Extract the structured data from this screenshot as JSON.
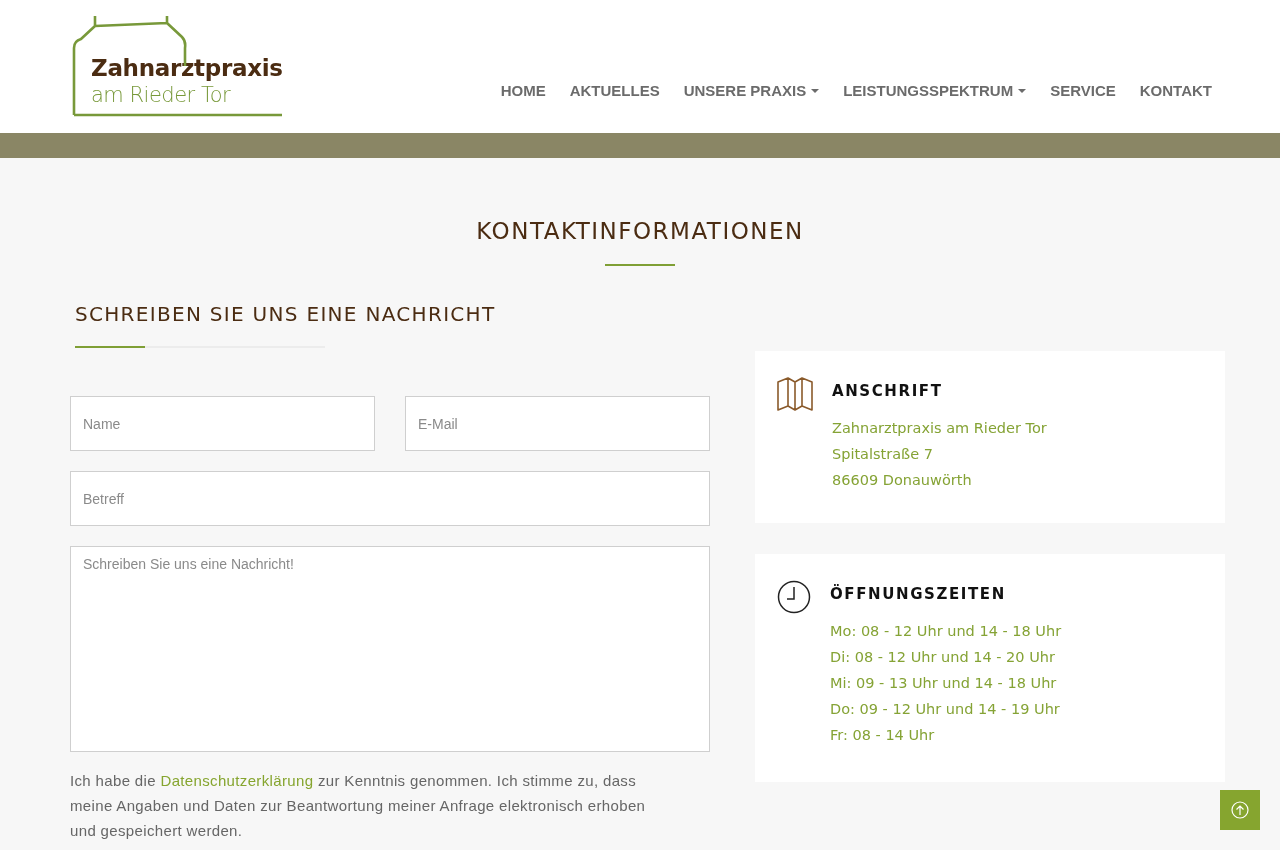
{
  "logo": {
    "name": "Zahnarztpraxis",
    "subtitle": "am Rieder Tor"
  },
  "nav": [
    {
      "label": "HOME",
      "dropdown": false
    },
    {
      "label": "AKTUELLES",
      "dropdown": false
    },
    {
      "label": "UNSERE PRAXIS",
      "dropdown": true
    },
    {
      "label": "LEISTUNGSSPEKTRUM",
      "dropdown": true
    },
    {
      "label": "SERVICE",
      "dropdown": false
    },
    {
      "label": "KONTAKT",
      "dropdown": false
    }
  ],
  "page_title": "KONTAKTINFORMATIONEN",
  "form": {
    "title": "SCHREIBEN SIE UNS EINE NACHRICHT",
    "name_field": {
      "placeholder": "Name"
    },
    "email_field": {
      "placeholder": "E-Mail"
    },
    "subject_field": {
      "placeholder": "Betreff"
    },
    "message_field": {
      "placeholder": "Schreiben Sie uns eine Nachricht!"
    },
    "consent": {
      "before": "Ich habe die ",
      "link": "Datenschutzerklärung",
      "after": " zur Kenntnis genommen. Ich stimme zu, dass meine Angaben und Daten zur Beantwortung meiner Anfrage elektronisch erhoben und gespeichert werden."
    }
  },
  "cards": [
    {
      "kind": "address",
      "title": "ANSCHRIFT",
      "lines": [
        "Zahnarztpraxis am Rieder Tor",
        "Spitalstraße 7",
        "86609 Donauwörth"
      ]
    },
    {
      "kind": "hours",
      "title": "ÖFFNUNGSZEITEN",
      "lines": [
        "Mo: 08 - 12 Uhr und 14 - 18 Uhr",
        "Di: 08 - 12 Uhr und 14 - 20 Uhr",
        "Mi: 09 - 13 Uhr und 14 - 18 Uhr",
        "Do: 09 - 12 Uhr und 14 - 19 Uhr",
        "Fr: 08 - 14 Uhr"
      ]
    }
  ]
}
